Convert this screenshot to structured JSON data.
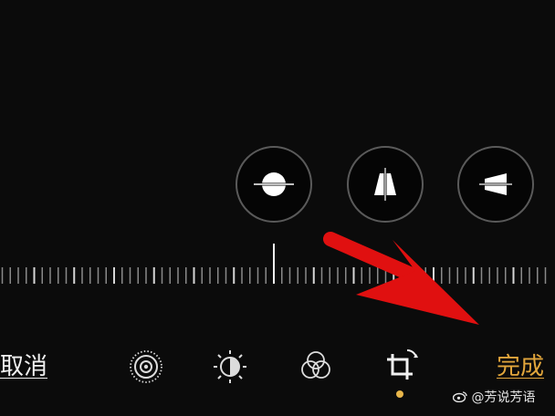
{
  "perspective_buttons": [
    {
      "name": "horizontal-straighten",
      "icon": "horizon-level-icon"
    },
    {
      "name": "vertical-perspective",
      "icon": "vertical-perspective-icon"
    },
    {
      "name": "horizontal-perspective",
      "icon": "horizontal-perspective-icon"
    }
  ],
  "ruler": {
    "value_degrees": 0
  },
  "toolbar": {
    "cancel_label": "取消",
    "done_label": "完成",
    "tools": [
      "live-photo-icon",
      "adjust-icon",
      "filters-icon",
      "crop-rotate-icon"
    ],
    "active_tool": "crop-rotate-icon"
  },
  "watermark": {
    "text": "@芳说芳语",
    "icon": "weibo-icon"
  },
  "colors": {
    "accent": "#e2a63c",
    "arrow": "#e01010",
    "background": "#0b0b0b"
  }
}
